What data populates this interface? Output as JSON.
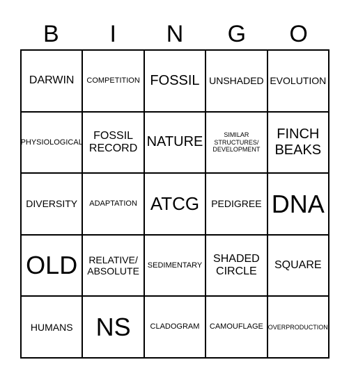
{
  "header": {
    "letters": [
      "B",
      "I",
      "N",
      "G",
      "O"
    ]
  },
  "cells": [
    [
      {
        "text": "DARWIN",
        "size": "s-lg"
      },
      {
        "text": "COMPETITION",
        "size": "s-sm"
      },
      {
        "text": "FOSSIL",
        "size": "s-xl"
      },
      {
        "text": "UNSHADED",
        "size": "s-md"
      },
      {
        "text": "EVOLUTION",
        "size": "s-md"
      }
    ],
    [
      {
        "text": "PHYSIOLOGICAL",
        "size": "s-sm"
      },
      {
        "text": "FOSSIL\nRECORD",
        "size": "s-lg"
      },
      {
        "text": "NATURE",
        "size": "s-xl"
      },
      {
        "text": "SIMILAR\nSTRUCTURES/\nDEVELOPMENT",
        "size": "s-xs"
      },
      {
        "text": "FINCH\nBEAKS",
        "size": "s-xl"
      }
    ],
    [
      {
        "text": "DIVERSITY",
        "size": "s-md"
      },
      {
        "text": "ADAPTATION",
        "size": "s-sm"
      },
      {
        "text": "ATCG",
        "size": "s-xxl"
      },
      {
        "text": "PEDIGREE",
        "size": "s-md"
      },
      {
        "text": "DNA",
        "size": "s-huge"
      }
    ],
    [
      {
        "text": "OLD",
        "size": "s-huge"
      },
      {
        "text": "RELATIVE/\nABSOLUTE",
        "size": "s-md"
      },
      {
        "text": "SEDIMENTARY",
        "size": "s-sm"
      },
      {
        "text": "SHADED\nCIRCLE",
        "size": "s-lg"
      },
      {
        "text": "SQUARE",
        "size": "s-lg"
      }
    ],
    [
      {
        "text": "HUMANS",
        "size": "s-md"
      },
      {
        "text": "NS",
        "size": "s-huge"
      },
      {
        "text": "CLADOGRAM",
        "size": "s-sm"
      },
      {
        "text": "CAMOUFLAGE",
        "size": "s-sm"
      },
      {
        "text": "OVERPRODUCTION",
        "size": "s-xs"
      }
    ]
  ]
}
